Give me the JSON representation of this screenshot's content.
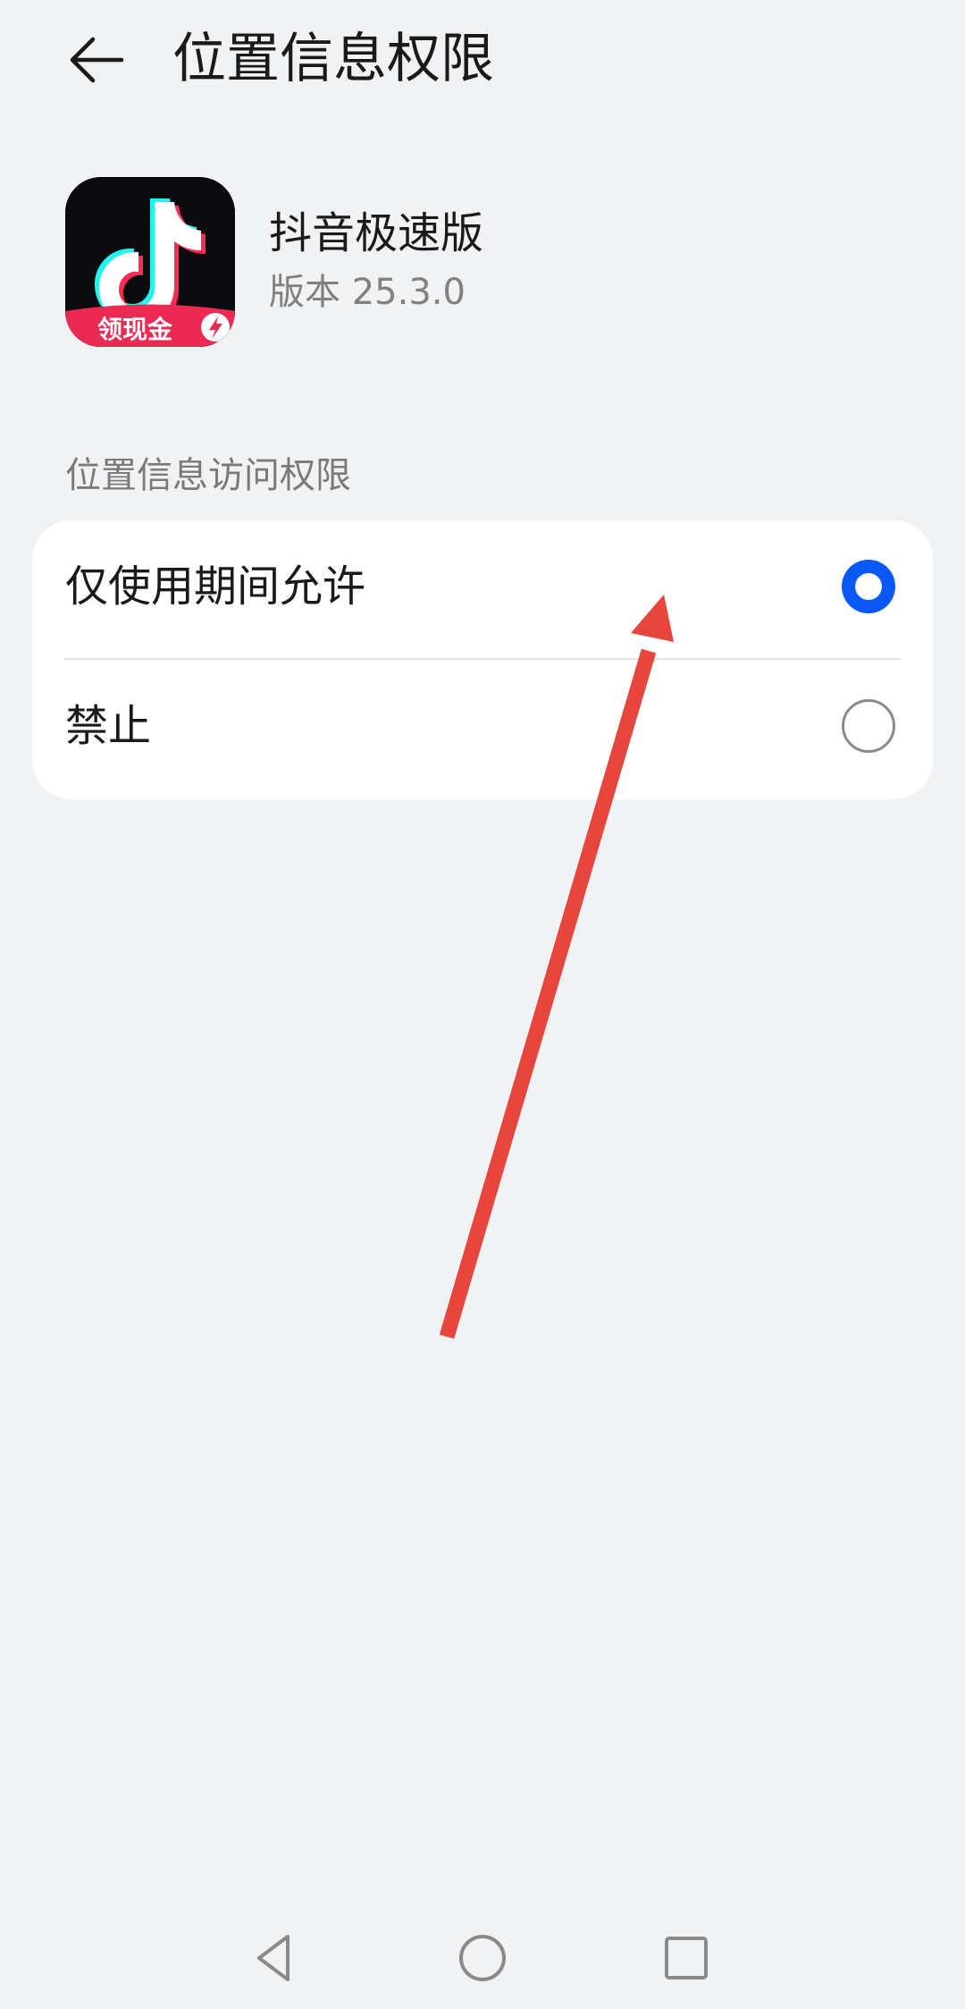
{
  "header": {
    "title": "位置信息权限",
    "back_icon": "arrow-left-icon"
  },
  "app": {
    "name": "抖音极速版",
    "version": "版本 25.3.0",
    "icon_badge": "领现金",
    "icon": "douyin-lite-app-icon"
  },
  "section": {
    "label": "位置信息访问权限"
  },
  "options": [
    {
      "label": "仅使用期间允许",
      "selected": true
    },
    {
      "label": "禁止",
      "selected": false
    }
  ],
  "nav": {
    "back_icon": "triangle-back-icon",
    "home_icon": "circle-home-icon",
    "recents_icon": "square-recents-icon"
  },
  "colors": {
    "background": "#f1f2f4",
    "card": "#ffffff",
    "accent": "#0a59f7",
    "annotation": "#e8453c"
  }
}
